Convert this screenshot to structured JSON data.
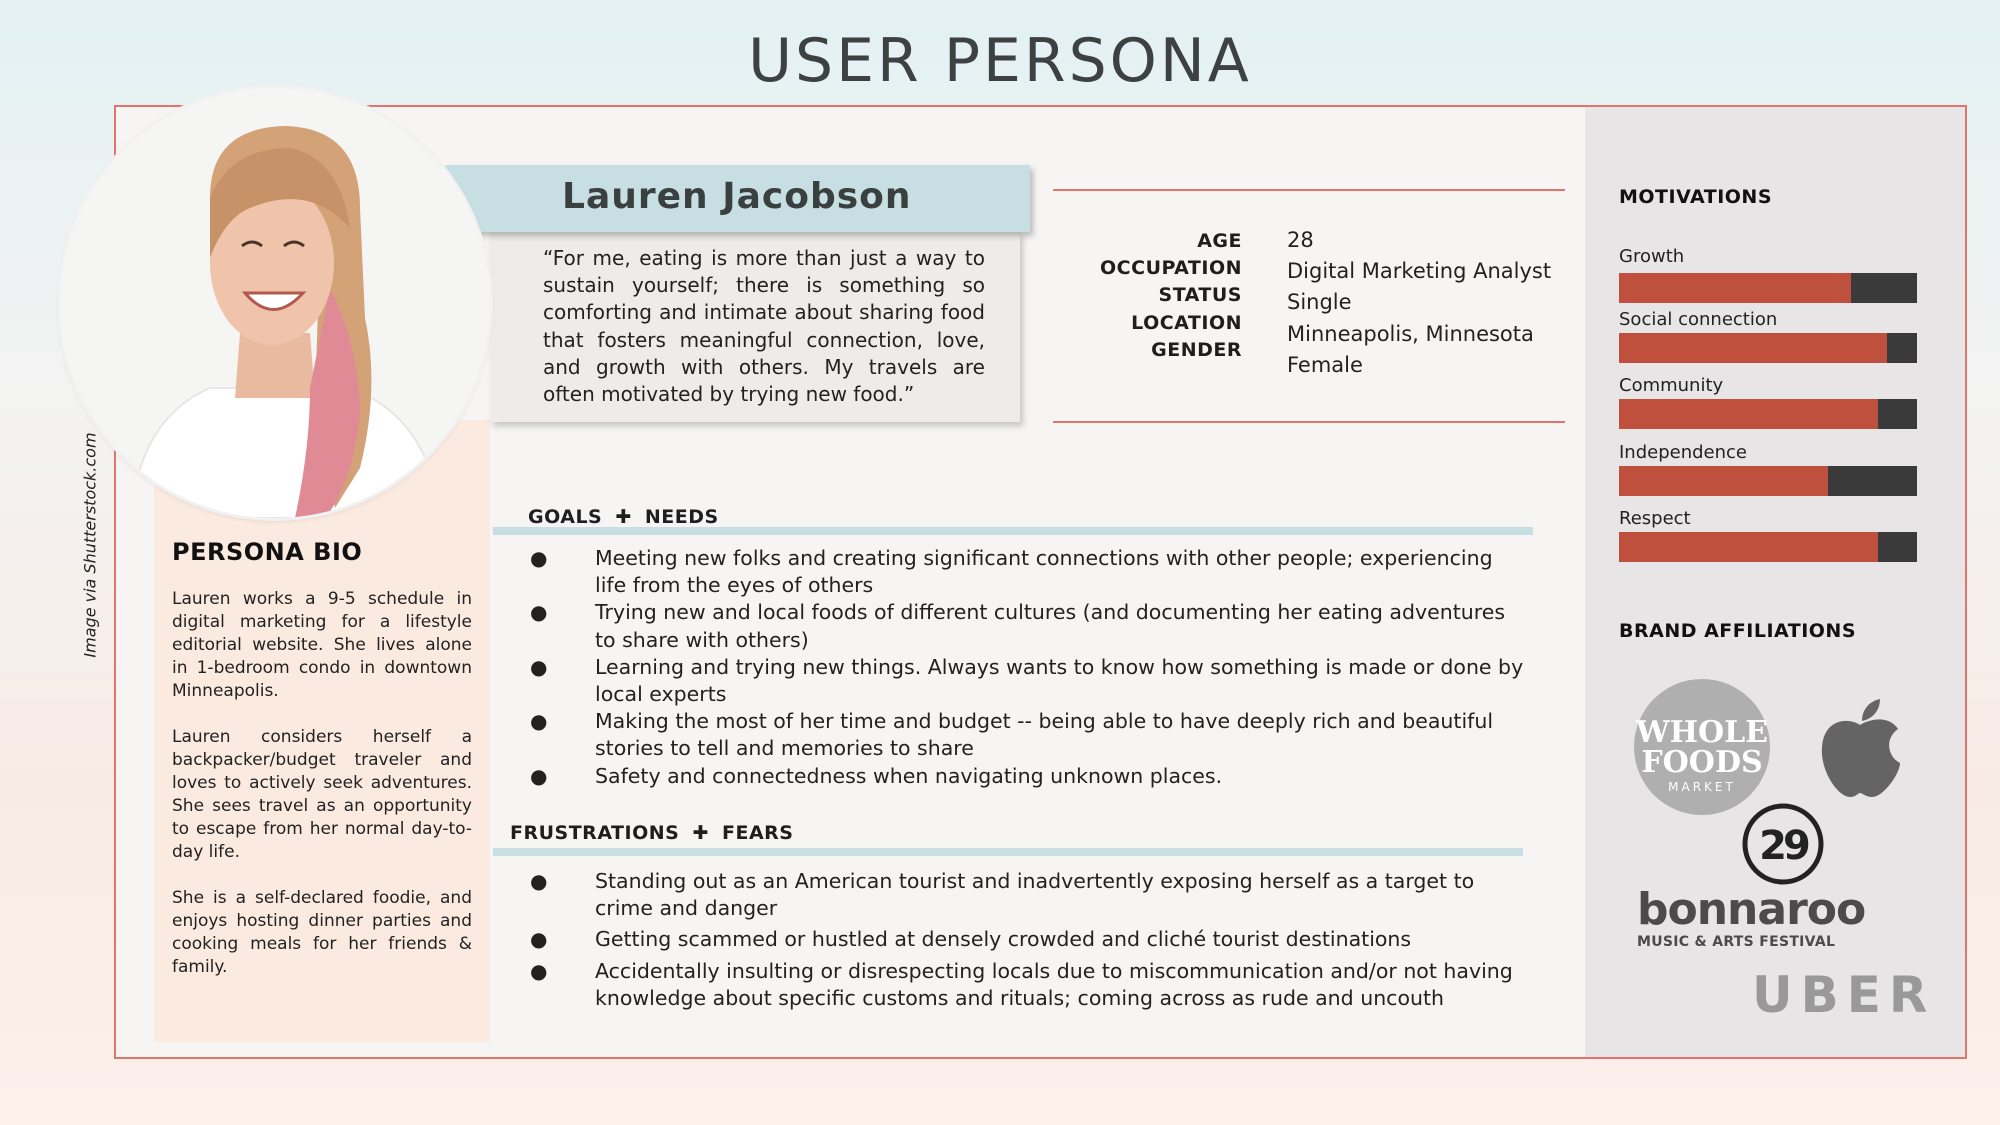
{
  "page_title": "USER PERSONA",
  "credit": "Image via Shutterstock.com",
  "persona": {
    "name": "Lauren Jacobson",
    "quote": "“For me, eating is more than just a way to sustain yourself; there is something so comforting and intimate about sharing food that fosters meaningful connection, love, and growth with others. My travels are often motivated by trying new food.”"
  },
  "demographics": {
    "labels": [
      "AGE",
      "OCCUPATION",
      "STATUS",
      "LOCATION",
      "GENDER"
    ],
    "values": [
      "28",
      "Digital Marketing Analyst",
      "Single",
      "Minneapolis, Minnesota",
      "Female"
    ]
  },
  "goals": {
    "heading_a": "GOALS",
    "heading_b": "NEEDS",
    "plus": "✚",
    "bullet": "●",
    "items": [
      "Meeting new folks and creating significant connections with other people; experiencing life from the eyes of others",
      "Trying new and local foods of different cultures (and documenting her eating adventures to share with others)",
      "Learning and trying new things. Always wants to know how something is made or done by local experts",
      "Making the most of her time and budget -- being able to have deeply rich and beautiful stories to tell and memories to share",
      "Safety and connectedness when navigating unknown places."
    ]
  },
  "frustrations": {
    "heading_a": "FRUSTRATIONS",
    "heading_b": "FEARS",
    "items": [
      "Standing out as an American tourist and inadvertently exposing herself as a target to crime and danger",
      "Getting scammed or hustled at densely crowded and cliché tourist destinations",
      "Accidentally insulting or disrespecting locals due to miscommunication and/or not having knowledge about specific customs and rituals; coming across as rude and uncouth"
    ]
  },
  "bio": {
    "title": "PERSONA BIO",
    "paragraphs": [
      "Lauren works a 9-5 schedule in digital marketing for a lifestyle editorial website. She lives alone in 1-bedroom condo in downtown Minneapolis.",
      "Lauren considers herself a backpacker/budget traveler and loves to actively seek adventures. She sees travel as an opportunity to escape from her normal day-to-day life.",
      "She is a self-declared foodie, and enjoys hosting dinner parties and cooking meals for her friends & family."
    ]
  },
  "motivations": {
    "title": "MOTIVATIONS",
    "items": [
      {
        "label": "Growth",
        "value": 0.78
      },
      {
        "label": "Social connection",
        "value": 0.9
      },
      {
        "label": "Community",
        "value": 0.87
      },
      {
        "label": "Independence",
        "value": 0.7
      },
      {
        "label": "Respect",
        "value": 0.87
      }
    ],
    "fill_color": "#c0503e",
    "track_color": "#3a3a3a"
  },
  "brands": {
    "title": "BRAND AFFILIATIONS",
    "whole_foods": {
      "line1": "WHOLE",
      "line2": "FOODS",
      "line3": "MARKET"
    },
    "refinery": {
      "mark": "29"
    },
    "bonnaroo": {
      "name": "bonnaroo",
      "tagline": "MUSIC & ARTS FESTIVAL"
    },
    "uber": {
      "name": "UBER"
    },
    "apple": {
      "icon": "apple-logo-icon"
    }
  },
  "colors": {
    "accent": "#e1756b",
    "banner": "#c7dfe3",
    "bio_bg": "#fbeadf",
    "side_bg": "#e7e5e5"
  }
}
